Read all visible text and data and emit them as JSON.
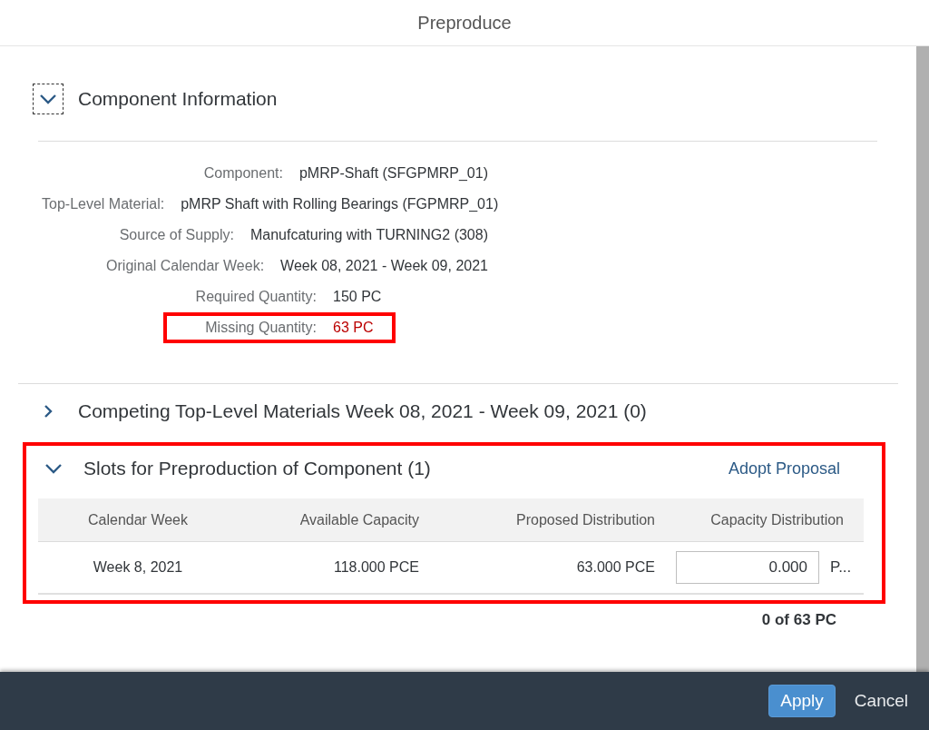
{
  "dialog": {
    "title": "Preproduce"
  },
  "component_section": {
    "title": "Component Information",
    "expanded": true,
    "fields": [
      {
        "label": "Component:",
        "value": "pMRP-Shaft (SFGPMRP_01)",
        "negative": false,
        "highlighted": false
      },
      {
        "label": "Top-Level Material:",
        "value": "pMRP Shaft with Rolling Bearings (FGPMRP_01)",
        "negative": false,
        "highlighted": false
      },
      {
        "label": "Source of Supply:",
        "value": "Manufcaturing with TURNING2 (308)",
        "negative": false,
        "highlighted": false
      },
      {
        "label": "Original Calendar Week:",
        "value": "Week 08, 2021 - Week 09, 2021",
        "negative": false,
        "highlighted": false
      },
      {
        "label": "Required Quantity:",
        "value": "150 PC",
        "negative": false,
        "highlighted": false
      },
      {
        "label": "Missing Quantity:",
        "value": "63 PC",
        "negative": true,
        "highlighted": true
      }
    ]
  },
  "competing_section": {
    "title": "Competing Top-Level Materials Week 08, 2021 - Week 09, 2021 (0)",
    "expanded": false
  },
  "slots_section": {
    "title": "Slots for Preproduction of Component (1)",
    "expanded": true,
    "highlighted": true,
    "action": "Adopt Proposal",
    "table": {
      "columns": [
        "Calendar Week",
        "Available Capacity",
        "Proposed Distribution",
        "Capacity Distribution"
      ],
      "rows": [
        {
          "calendar_week": "Week 8, 2021",
          "available_capacity": "118.000 PCE",
          "proposed_distribution": "63.000 PCE",
          "capacity_distribution": "0.000",
          "unit": "P..."
        }
      ]
    },
    "total": "0 of 63 PC"
  },
  "footer": {
    "buttons": [
      {
        "label": "Apply",
        "kind": "emphasized"
      },
      {
        "label": "Cancel",
        "kind": "transparent"
      }
    ]
  }
}
